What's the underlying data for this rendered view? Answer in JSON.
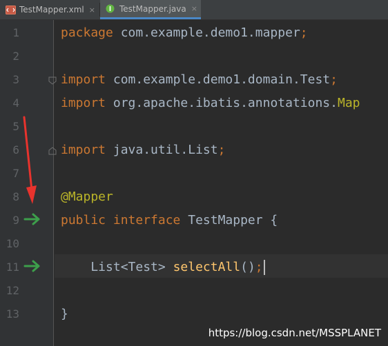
{
  "tabs": [
    {
      "label": "TestMapper.xml",
      "icon": "xml-file-icon",
      "active": false
    },
    {
      "label": "TestMapper.java",
      "icon": "java-interface-icon",
      "active": true
    }
  ],
  "close_glyph": "×",
  "lines": [
    {
      "num": "1",
      "tokens": [
        [
          "kw",
          "package"
        ],
        [
          "txt",
          " com.example.demo1.mapper"
        ],
        [
          "kw",
          ";"
        ]
      ]
    },
    {
      "num": "2",
      "tokens": []
    },
    {
      "num": "3",
      "tokens": [
        [
          "kw",
          "import"
        ],
        [
          "txt",
          " com.example.demo1.domain.Test"
        ],
        [
          "kw",
          ";"
        ]
      ]
    },
    {
      "num": "4",
      "tokens": [
        [
          "kw",
          "import"
        ],
        [
          "txt",
          " org.apache.ibatis.annotations."
        ],
        [
          "ann",
          "Map"
        ]
      ]
    },
    {
      "num": "5",
      "tokens": []
    },
    {
      "num": "6",
      "tokens": [
        [
          "kw",
          "import"
        ],
        [
          "txt",
          " java.util.List"
        ],
        [
          "kw",
          ";"
        ]
      ]
    },
    {
      "num": "7",
      "tokens": []
    },
    {
      "num": "8",
      "tokens": [
        [
          "ann",
          "@Mapper"
        ]
      ]
    },
    {
      "num": "9",
      "tokens": [
        [
          "kw",
          "public interface"
        ],
        [
          "txt",
          " TestMapper {"
        ]
      ]
    },
    {
      "num": "10",
      "tokens": []
    },
    {
      "num": "11",
      "tokens": [
        [
          "txt",
          "    List<Test> "
        ],
        [
          "fn",
          "selectAll"
        ],
        [
          "txt",
          "()"
        ],
        [
          "kw",
          ";"
        ]
      ]
    },
    {
      "num": "12",
      "tokens": []
    },
    {
      "num": "13",
      "tokens": [
        [
          "txt",
          "}"
        ]
      ]
    }
  ],
  "watermark": "https://blog.csdn.net/MSSPLANET",
  "colors": {
    "background": "#2b2b2b",
    "keyword": "#cc7832",
    "annotation": "#bbb529",
    "method": "#ffc66d",
    "text": "#a9b7c6",
    "run_arrow": "#3d9f4b",
    "red_arrow": "#e8332d"
  }
}
